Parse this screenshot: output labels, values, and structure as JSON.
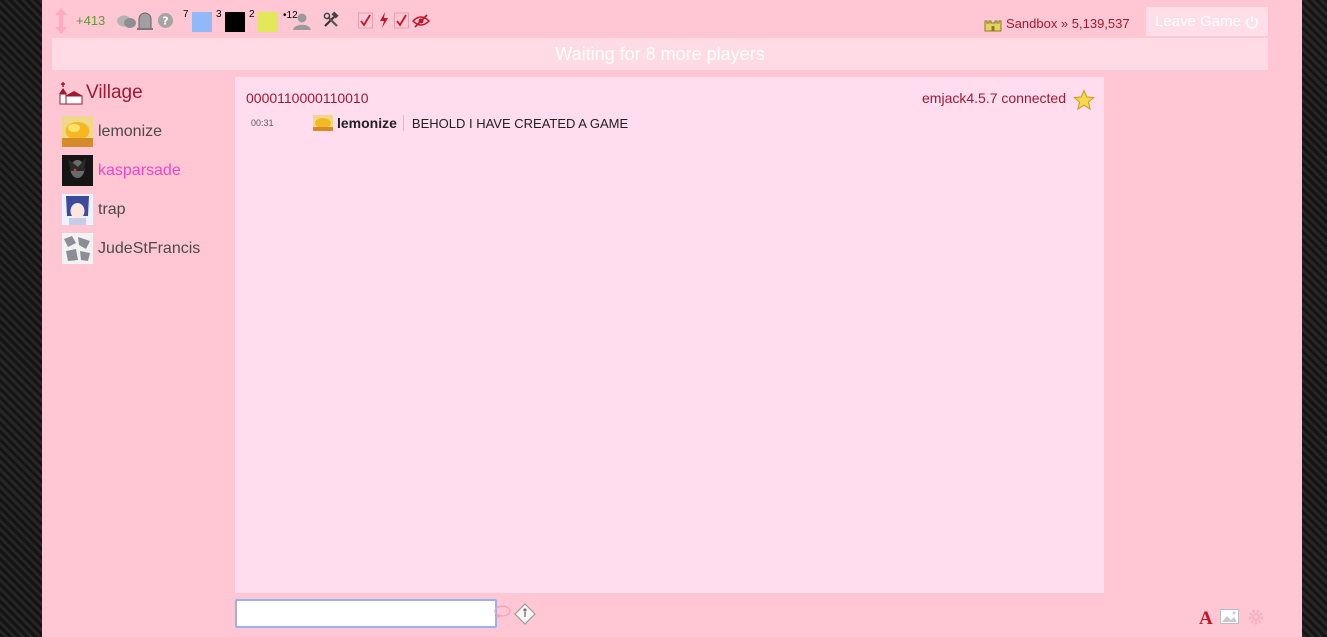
{
  "topbar": {
    "score": "+413",
    "counts": {
      "blue": "7",
      "black": "3",
      "yellow": "2",
      "user": "•12"
    },
    "swatches": {
      "blue": "#91b9f8",
      "black": "#000000",
      "yellow": "#e3e75a"
    },
    "icons": [
      "updown-arrows-icon",
      "chat-bubbles-icon",
      "tombstone-icon",
      "help-icon",
      "tools-icon",
      "check-icon",
      "lightning-icon",
      "check-icon",
      "hidden-eye-icon"
    ],
    "sandbox_label": "Sandbox » 5,139,537",
    "leave_label": "Leave Game"
  },
  "banner": {
    "text": "Waiting for 8 more players"
  },
  "sidebar": {
    "title": "Village",
    "players": [
      {
        "name": "lemonize",
        "highlight": false
      },
      {
        "name": "kasparsade",
        "highlight": true
      },
      {
        "name": "trap",
        "highlight": false
      },
      {
        "name": "JudeStFrancis",
        "highlight": false
      }
    ]
  },
  "chat": {
    "game_id": "0000110000110010",
    "connection": "emjack4.5.7 connected",
    "messages": [
      {
        "time": "00:31",
        "author": "lemonize",
        "text": "BEHOLD I HAVE CREATED A GAME"
      }
    ]
  },
  "input": {
    "value": ""
  },
  "colors": {
    "accent": "#9d1a33",
    "frame": "#ffc7d4",
    "panel": "#ffdcee",
    "highlight": "#ee46c4"
  }
}
